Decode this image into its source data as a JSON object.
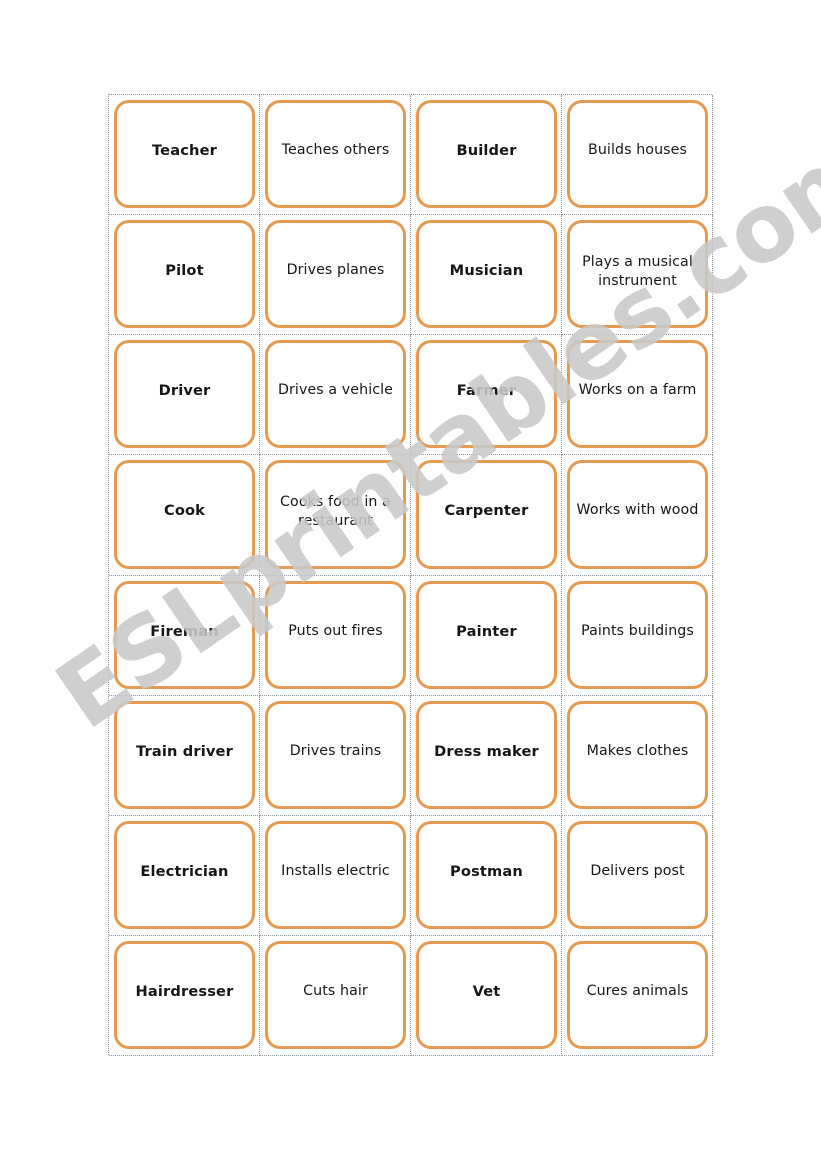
{
  "watermark": {
    "text": "ESLprintables.com",
    "color": "#c9c9c9"
  },
  "style": {
    "card_border_color": "#e49a52",
    "grid_line_color": "#8c93a8",
    "text_color": "#161616",
    "page_background": "#ffffff"
  },
  "worksheet": {
    "columns": 4,
    "rows": 8,
    "cards": [
      {
        "text": "Teacher",
        "kind": "job"
      },
      {
        "text": "Teaches others",
        "kind": "desc"
      },
      {
        "text": "Builder",
        "kind": "job"
      },
      {
        "text": "Builds houses",
        "kind": "desc"
      },
      {
        "text": "Pilot",
        "kind": "job"
      },
      {
        "text": "Drives planes",
        "kind": "desc"
      },
      {
        "text": "Musician",
        "kind": "job"
      },
      {
        "text": "Plays a musical instrument",
        "kind": "desc"
      },
      {
        "text": "Driver",
        "kind": "job"
      },
      {
        "text": "Drives a vehicle",
        "kind": "desc"
      },
      {
        "text": "Farmer",
        "kind": "job"
      },
      {
        "text": "Works on a farm",
        "kind": "desc"
      },
      {
        "text": "Cook",
        "kind": "job"
      },
      {
        "text": "Cooks food in a restaurant",
        "kind": "desc"
      },
      {
        "text": "Carpenter",
        "kind": "job"
      },
      {
        "text": "Works with wood",
        "kind": "desc"
      },
      {
        "text": "Fireman",
        "kind": "job"
      },
      {
        "text": "Puts out fires",
        "kind": "desc"
      },
      {
        "text": "Painter",
        "kind": "job"
      },
      {
        "text": "Paints buildings",
        "kind": "desc"
      },
      {
        "text": "Train driver",
        "kind": "job"
      },
      {
        "text": "Drives trains",
        "kind": "desc"
      },
      {
        "text": "Dress maker",
        "kind": "job"
      },
      {
        "text": "Makes clothes",
        "kind": "desc"
      },
      {
        "text": "Electrician",
        "kind": "job"
      },
      {
        "text": "Installs electric",
        "kind": "desc"
      },
      {
        "text": "Postman",
        "kind": "job"
      },
      {
        "text": "Delivers post",
        "kind": "desc"
      },
      {
        "text": "Hairdresser",
        "kind": "job"
      },
      {
        "text": "Cuts hair",
        "kind": "desc"
      },
      {
        "text": "Vet",
        "kind": "job"
      },
      {
        "text": "Cures animals",
        "kind": "desc"
      }
    ]
  }
}
